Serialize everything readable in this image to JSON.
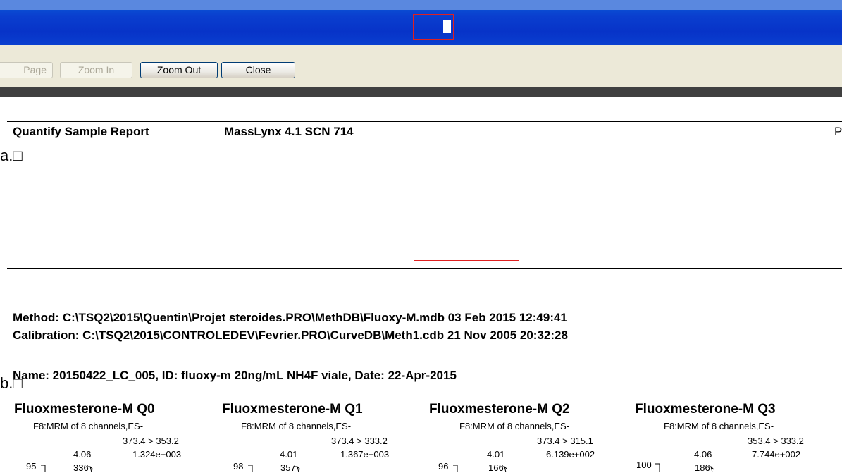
{
  "toolbar": {
    "buttons": [
      {
        "label": "Page",
        "enabled": false
      },
      {
        "label": "Zoom In",
        "enabled": false
      },
      {
        "label": "Zoom Out",
        "enabled": true
      },
      {
        "label": "Close",
        "enabled": true
      }
    ]
  },
  "report": {
    "title": "Quantify Sample Report",
    "software": "MassLynx 4.1 SCN 714",
    "page_letter": "P",
    "method": "Method: C:\\TSQ2\\2015\\Quentin\\Projet steroides.PRO\\MethDB\\Fluoxy-M.mdb 03 Feb 2015 12:49:41",
    "calibration": "Calibration: C:\\TSQ2\\2015\\CONTROLEDEV\\Fevrier.PRO\\CurveDB\\Meth1.cdb 21 Nov 2005 20:32:28",
    "name_line": "Name: 20150422_LC_005, ID: fluoxy-m 20ng/mL NH4F viale, Date: 22-Apr-2015"
  },
  "annotations": {
    "a": "a.□",
    "b": "b.□",
    "highlight_color": "#e02020"
  },
  "chromatograms": [
    {
      "title": "Fluoxmesterone-M Q0",
      "channel": "F8:MRM of 8 channels,ES-",
      "transition": "373.4 > 353.2",
      "rt": "4.06",
      "intensity": "1.324e+003",
      "area": "336",
      "yaxis": "95"
    },
    {
      "title": "Fluoxmesterone-M Q1",
      "channel": "F8:MRM of 8 channels,ES-",
      "transition": "373.4 > 333.2",
      "rt": "4.01",
      "intensity": "1.367e+003",
      "area": "357",
      "yaxis": "98"
    },
    {
      "title": "Fluoxmesterone-M Q2",
      "channel": "F8:MRM of 8 channels,ES-",
      "transition": "373.4 > 315.1",
      "rt": "4.01",
      "intensity": "6.139e+002",
      "area": "166",
      "yaxis": "96"
    },
    {
      "title": "Fluoxmesterone-M Q3",
      "channel": "F8:MRM of 8 channels,ES-",
      "transition": "353.4 > 333.2",
      "rt": "4.06",
      "intensity": "7.744e+002",
      "area": "186",
      "yaxis": "100"
    }
  ]
}
